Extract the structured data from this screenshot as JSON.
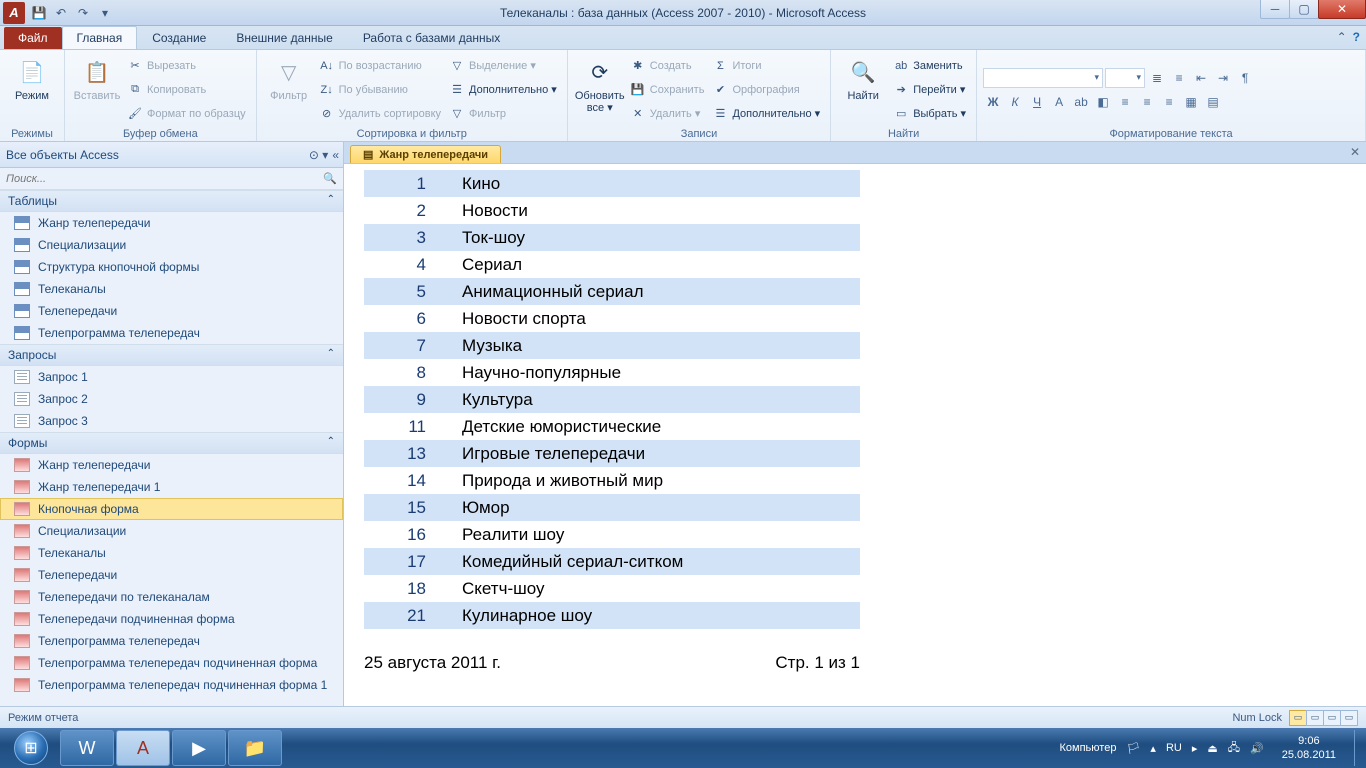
{
  "title": "Телеканалы : база данных (Access 2007 - 2010)  -  Microsoft Access",
  "tabs": {
    "file": "Файл",
    "home": "Главная",
    "create": "Создание",
    "extdata": "Внешние данные",
    "dbtools": "Работа с базами данных"
  },
  "ribbon": {
    "views": {
      "mode": "Режим",
      "group": "Режимы"
    },
    "clipboard": {
      "paste": "Вставить",
      "cut": "Вырезать",
      "copy": "Копировать",
      "fmt": "Формат по образцу",
      "group": "Буфер обмена"
    },
    "sortfilter": {
      "filter": "Фильтр",
      "asc": "По возрастанию",
      "desc": "По убыванию",
      "clear": "Удалить сортировку",
      "sel": "Выделение ▾",
      "adv": "Дополнительно ▾",
      "tgl": "Фильтр",
      "group": "Сортировка и фильтр"
    },
    "records": {
      "refresh": "Обновить\nвсе ▾",
      "new": "Создать",
      "save": "Сохранить",
      "del": "Удалить ▾",
      "totals": "Итоги",
      "spell": "Орфография",
      "more": "Дополнительно ▾",
      "group": "Записи"
    },
    "find": {
      "find": "Найти",
      "replace": "Заменить",
      "goto": "Перейти ▾",
      "select": "Выбрать ▾",
      "group": "Найти"
    },
    "format": {
      "group": "Форматирование текста"
    }
  },
  "nav": {
    "title": "Все объекты Access",
    "search_ph": "Поиск...",
    "cats": {
      "tables": "Таблицы",
      "queries": "Запросы",
      "forms": "Формы"
    },
    "tables": [
      "Жанр телепередачи",
      "Специализации",
      "Структура кнопочной формы",
      "Телеканалы",
      "Телепередачи",
      "Телепрограмма телепередач"
    ],
    "queries": [
      "Запрос 1",
      "Запрос 2",
      "Запрос 3"
    ],
    "forms": [
      "Жанр телепередачи",
      "Жанр телепередачи 1",
      "Кнопочная форма",
      "Специализации",
      "Телеканалы",
      "Телепередачи",
      "Телепередачи по телеканалам",
      "Телепередачи подчиненная форма",
      "Телепрограмма телепередач",
      "Телепрограмма телепередач подчиненная форма",
      "Телепрограмма телепередач подчиненная форма 1"
    ],
    "selected_form": "Кнопочная форма"
  },
  "doc": {
    "tab": "Жанр телепередачи"
  },
  "report": {
    "rows": [
      {
        "id": 1,
        "name": "Кино"
      },
      {
        "id": 2,
        "name": "Новости"
      },
      {
        "id": 3,
        "name": "Ток-шоу"
      },
      {
        "id": 4,
        "name": "Сериал"
      },
      {
        "id": 5,
        "name": "Анимационный сериал"
      },
      {
        "id": 6,
        "name": "Новости спорта"
      },
      {
        "id": 7,
        "name": "Музыка"
      },
      {
        "id": 8,
        "name": "Научно-популярные"
      },
      {
        "id": 9,
        "name": "Культура"
      },
      {
        "id": 11,
        "name": "Детские юмористические"
      },
      {
        "id": 13,
        "name": "Игровые телепередачи"
      },
      {
        "id": 14,
        "name": "Природа и животный мир"
      },
      {
        "id": 15,
        "name": "Юмор"
      },
      {
        "id": 16,
        "name": "Реалити шоу"
      },
      {
        "id": 17,
        "name": "Комедийный сериал-ситком"
      },
      {
        "id": 18,
        "name": "Скетч-шоу"
      },
      {
        "id": 21,
        "name": "Кулинарное шоу"
      }
    ],
    "date": "25 августа 2011 г.",
    "page": "Стр. 1 из 1"
  },
  "status": {
    "mode": "Режим отчета",
    "numlock": "Num Lock"
  },
  "taskbar": {
    "computer": "Компьютер",
    "lang": "RU",
    "time": "9:06",
    "date": "25.08.2011"
  }
}
